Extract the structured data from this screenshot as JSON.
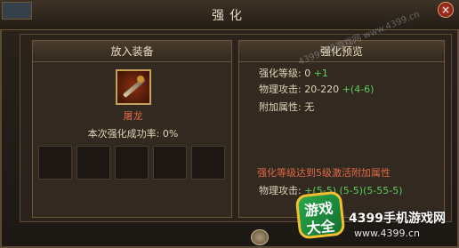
{
  "window": {
    "title": "强化",
    "close_label": "×"
  },
  "left_panel": {
    "header": "放入装备",
    "item_name": "屠龙",
    "success_rate_label": "本次强化成功率:",
    "success_rate_value": "0%",
    "slot_count": 5
  },
  "right_panel": {
    "header": "强化预览",
    "level_label": "强化等级:",
    "level_value": "0",
    "level_plus": "+1",
    "attack_label": "物理攻击:",
    "attack_value": "20-220",
    "attack_plus": "+(4-6)",
    "extra_label": "附加属性:",
    "extra_value": "无",
    "notice": "强化等级达到5级激活附加属性",
    "bonus_label": "物理攻击:",
    "bonus_value": "+(5-5)",
    "bonus_detail": "(5-5)(5-55-5)"
  },
  "watermark": {
    "badge_top": "游戏",
    "badge_bottom": "大全",
    "site_name": "4399手机游戏网",
    "site_url": "www.4399.cn",
    "diagonal": "4399手机游戏网 www.4399.cn"
  },
  "colors": {
    "accent_red": "#e06848",
    "accent_green": "#5ccc5c",
    "frame_gold": "#6b5638"
  }
}
